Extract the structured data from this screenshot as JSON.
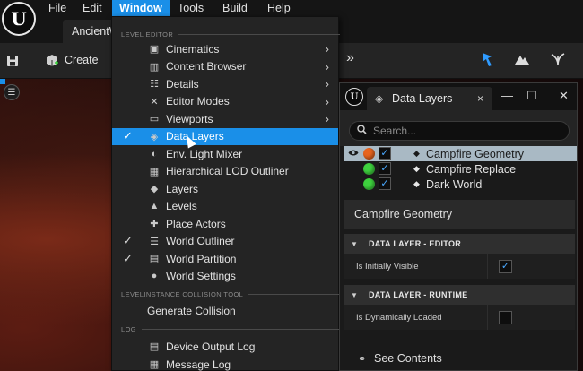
{
  "menubar": {
    "logo_glyph": "U",
    "items": [
      "File",
      "Edit",
      "Window",
      "Tools",
      "Build",
      "Help"
    ],
    "active": "Window"
  },
  "level_tab": {
    "label": "AncientW"
  },
  "toolbar": {
    "create_label": "Create",
    "icons": [
      "save-icon",
      "create-icon",
      "chevron-double-right-icon",
      "select-mode-icon",
      "landscape-icon",
      "foliage-icon"
    ]
  },
  "window_menu": {
    "sections": {
      "level_editor": "LEVEL EDITOR",
      "levelinstance": "LEVELINSTANCE COLLISION TOOL",
      "log": "LOG"
    },
    "items": [
      {
        "label": "Cinematics",
        "icon": "cinematics-icon",
        "submenu": true,
        "checked": false
      },
      {
        "label": "Content Browser",
        "icon": "content-browser-icon",
        "submenu": true,
        "checked": false
      },
      {
        "label": "Details",
        "icon": "details-icon",
        "submenu": true,
        "checked": false
      },
      {
        "label": "Editor Modes",
        "icon": "editor-modes-icon",
        "submenu": true,
        "checked": false
      },
      {
        "label": "Viewports",
        "icon": "viewports-icon",
        "submenu": true,
        "checked": false
      },
      {
        "label": "Data Layers",
        "icon": "data-layers-icon",
        "submenu": false,
        "checked": true
      },
      {
        "label": "Env. Light Mixer",
        "icon": "light-mixer-icon",
        "submenu": false,
        "checked": false
      },
      {
        "label": "Hierarchical LOD Outliner",
        "icon": "hlod-icon",
        "submenu": false,
        "checked": false
      },
      {
        "label": "Layers",
        "icon": "layers-icon",
        "submenu": false,
        "checked": false
      },
      {
        "label": "Levels",
        "icon": "levels-icon",
        "submenu": false,
        "checked": false
      },
      {
        "label": "Place Actors",
        "icon": "place-actors-icon",
        "submenu": false,
        "checked": false
      },
      {
        "label": "World Outliner",
        "icon": "world-outliner-icon",
        "submenu": false,
        "checked": true
      },
      {
        "label": "World Partition",
        "icon": "world-partition-icon",
        "submenu": false,
        "checked": true
      },
      {
        "label": "World Settings",
        "icon": "world-settings-icon",
        "submenu": false,
        "checked": false
      }
    ],
    "generate_collision": "Generate Collision",
    "log_items": [
      {
        "label": "Device Output Log",
        "icon": "device-output-log-icon"
      },
      {
        "label": "Message Log",
        "icon": "message-log-icon"
      }
    ],
    "highlighted": "Data Layers",
    "check_glyph": "✓",
    "submenu_glyph": "›"
  },
  "data_layers_panel": {
    "tab_label": "Data Layers",
    "close_glyph": "×",
    "search_placeholder": "Search...",
    "layers": [
      {
        "name": "Campfire Geometry",
        "status_color": "#e8641e",
        "visible": true,
        "checked": true,
        "selected": true
      },
      {
        "name": "Campfire Replace",
        "status_color": "#3ed23e",
        "visible": false,
        "checked": true,
        "selected": false
      },
      {
        "name": "Dark World",
        "status_color": "#3ed23e",
        "visible": false,
        "checked": true,
        "selected": false
      }
    ],
    "details_title": "Campfire Geometry",
    "categories": [
      {
        "label": "DATA LAYER - EDITOR",
        "property": "Is Initially Visible",
        "value": true
      },
      {
        "label": "DATA LAYER - RUNTIME",
        "property": "Is Dynamically Loaded",
        "value": false
      }
    ],
    "footer": "See Contents"
  },
  "colors": {
    "accent": "#1a8fe8",
    "menu_bg": "#242424",
    "selected_row": "#a9b9c4"
  }
}
